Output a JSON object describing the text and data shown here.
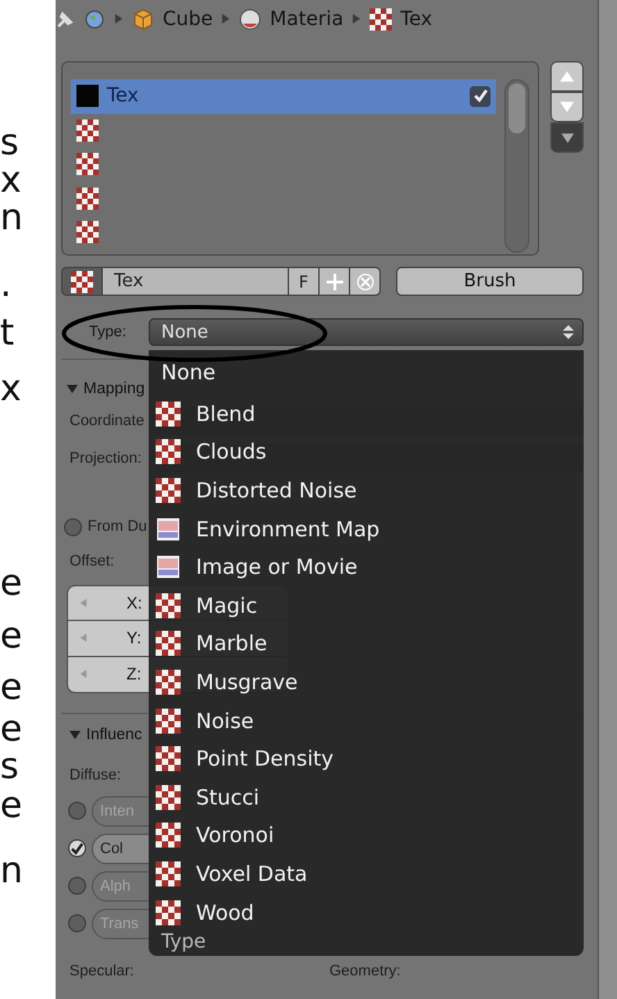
{
  "doc_margin": [
    "s",
    "x",
    "n",
    ".",
    "t",
    "x",
    "e",
    "e",
    "e",
    "e",
    "s",
    "e",
    "n"
  ],
  "breadcrumb": [
    {
      "label": "Cube",
      "kind": "cube"
    },
    {
      "label": "Materia",
      "kind": "material"
    },
    {
      "label": "Tex",
      "kind": "texture"
    }
  ],
  "texture_slots": [
    {
      "name": "Tex",
      "kind": "swatch",
      "selected": true,
      "checked": true
    },
    {
      "kind": "checker",
      "selected": false
    },
    {
      "kind": "checker",
      "selected": false
    },
    {
      "kind": "checker",
      "selected": false
    },
    {
      "kind": "checker",
      "selected": false
    }
  ],
  "datablock": {
    "name": "Tex",
    "fake_user": "F",
    "brush": "Brush"
  },
  "type_field": {
    "label": "Type:",
    "value": "None"
  },
  "annotation": {
    "kind": "ellipse"
  },
  "mapping": {
    "title": "Mapping",
    "expanded": true,
    "coordinates_label": "Coordinate",
    "projection_label": "Projection:",
    "from_dupli": {
      "label": "From Du",
      "checked": false
    },
    "offset_label": "Offset:",
    "axes": [
      "X:",
      "Y:",
      "Z:"
    ]
  },
  "influence": {
    "title": "Influenc",
    "expanded": true,
    "diffuse_label": "Diffuse:",
    "diffuse": [
      {
        "label": "Inten",
        "checked": false
      },
      {
        "label": "Col",
        "checked": true
      },
      {
        "label": "Alph",
        "checked": false
      },
      {
        "label": "Trans",
        "checked": false
      }
    ],
    "specular_label": "Specular:",
    "geometry_label": "Geometry:"
  },
  "type_menu": {
    "items": [
      {
        "label": "None",
        "kind": "plain"
      },
      {
        "label": "Blend",
        "kind": "procedural"
      },
      {
        "label": "Clouds",
        "kind": "procedural"
      },
      {
        "label": "Distorted Noise",
        "kind": "procedural"
      },
      {
        "label": "Environment Map",
        "kind": "image"
      },
      {
        "label": "Image or Movie",
        "kind": "image"
      },
      {
        "label": "Magic",
        "kind": "procedural"
      },
      {
        "label": "Marble",
        "kind": "procedural"
      },
      {
        "label": "Musgrave",
        "kind": "procedural"
      },
      {
        "label": "Noise",
        "kind": "procedural"
      },
      {
        "label": "Point Density",
        "kind": "procedural"
      },
      {
        "label": "Stucci",
        "kind": "procedural"
      },
      {
        "label": "Voronoi",
        "kind": "procedural"
      },
      {
        "label": "Voxel Data",
        "kind": "procedural"
      },
      {
        "label": "Wood",
        "kind": "procedural"
      }
    ],
    "footer": "Type"
  }
}
